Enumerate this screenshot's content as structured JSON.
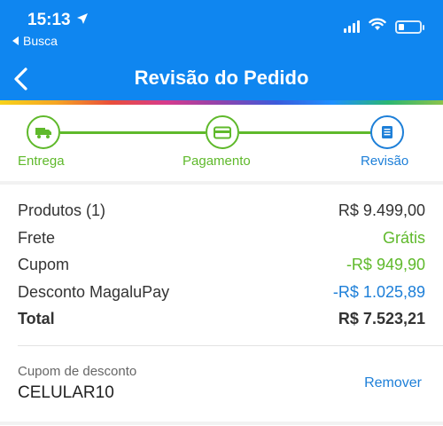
{
  "status_bar": {
    "time": "15:13",
    "back_app": "Busca"
  },
  "nav": {
    "title": "Revisão do Pedido"
  },
  "steps": [
    {
      "label": "Entrega",
      "icon": "truck-icon",
      "state": "done"
    },
    {
      "label": "Pagamento",
      "icon": "card-icon",
      "state": "done"
    },
    {
      "label": "Revisão",
      "icon": "list-icon",
      "state": "active"
    }
  ],
  "summary": {
    "rows": [
      {
        "label": "Produtos (1)",
        "value": "R$ 9.499,00"
      },
      {
        "label": "Frete",
        "value": "Grátis"
      },
      {
        "label": "Cupom",
        "value": "-R$ 949,90"
      },
      {
        "label": "Desconto MagaluPay",
        "value": "-R$ 1.025,89"
      },
      {
        "label": "Total",
        "value": "R$ 7.523,21"
      }
    ]
  },
  "coupon": {
    "label": "Cupom de desconto",
    "code": "CELULAR10",
    "remove_label": "Remover"
  },
  "colors": {
    "header": "#0f86f0",
    "success": "#5fb92b",
    "accent": "#1d7fd8"
  }
}
